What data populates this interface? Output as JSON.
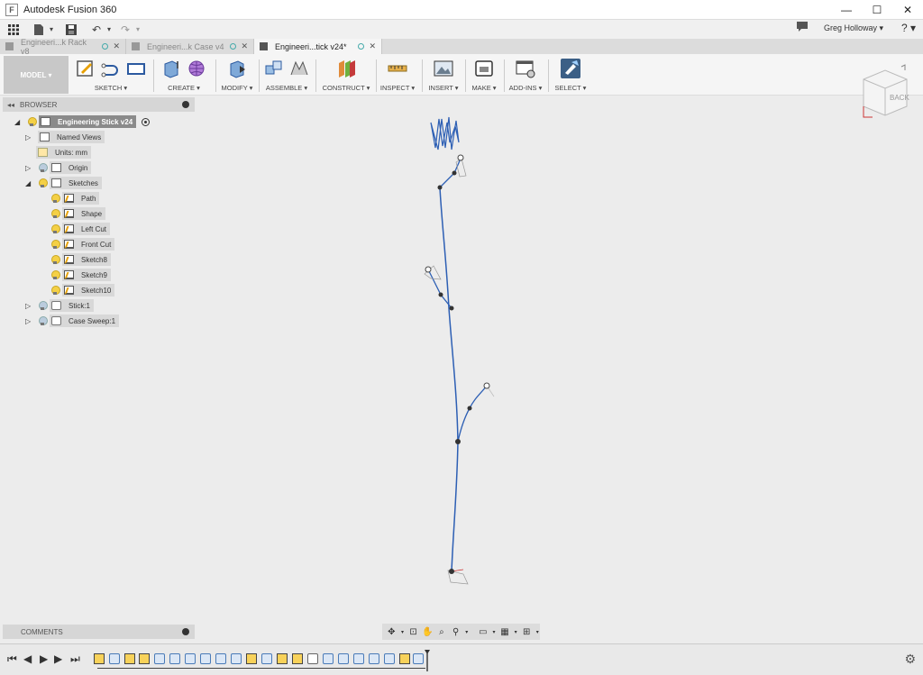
{
  "window": {
    "title": "Autodesk Fusion 360",
    "minimize": "—",
    "maximize": "☐",
    "close": "✕"
  },
  "quickbar": {
    "user": "Greg Holloway ▾",
    "help": "? ▾"
  },
  "tabs": [
    {
      "label": "Engineeri...k Rack v8",
      "close": "✕",
      "active": false
    },
    {
      "label": "Engineeri...k Case v4",
      "close": "✕",
      "active": false
    },
    {
      "label": "Engineeri...tick v24*",
      "close": "✕",
      "active": true
    }
  ],
  "toolbar": {
    "workspace": "MODEL ▾",
    "groups": [
      {
        "id": "sketch",
        "label": "SKETCH ▾"
      },
      {
        "id": "create",
        "label": "CREATE ▾"
      },
      {
        "id": "modify",
        "label": "MODIFY ▾"
      },
      {
        "id": "assemble",
        "label": "ASSEMBLE ▾"
      },
      {
        "id": "construct",
        "label": "CONSTRUCT ▾"
      },
      {
        "id": "inspect",
        "label": "INSPECT ▾"
      },
      {
        "id": "insert",
        "label": "INSERT ▾"
      },
      {
        "id": "make",
        "label": "MAKE ▾"
      },
      {
        "id": "addins",
        "label": "ADD-INS ▾"
      },
      {
        "id": "select",
        "label": "SELECT ▾"
      }
    ]
  },
  "viewcube": {
    "face": "BACK"
  },
  "browser": {
    "header": "BROWSER",
    "root": "Engineering Stick v24",
    "named_views": "Named Views",
    "units": "Units: mm",
    "origin": "Origin",
    "sketches": "Sketches",
    "sketch_items": [
      "Path",
      "Shape",
      "Left Cut",
      "Front Cut",
      "Sketch8",
      "Sketch9",
      "Sketch10"
    ],
    "bodies": [
      "Stick:1",
      "Case Sweep:1"
    ]
  },
  "comments": {
    "label": "COMMENTS"
  },
  "colors": {
    "accent": "#2c5aa0",
    "sketch_line": "#2d5fb4",
    "bulb": "#f4d046"
  }
}
